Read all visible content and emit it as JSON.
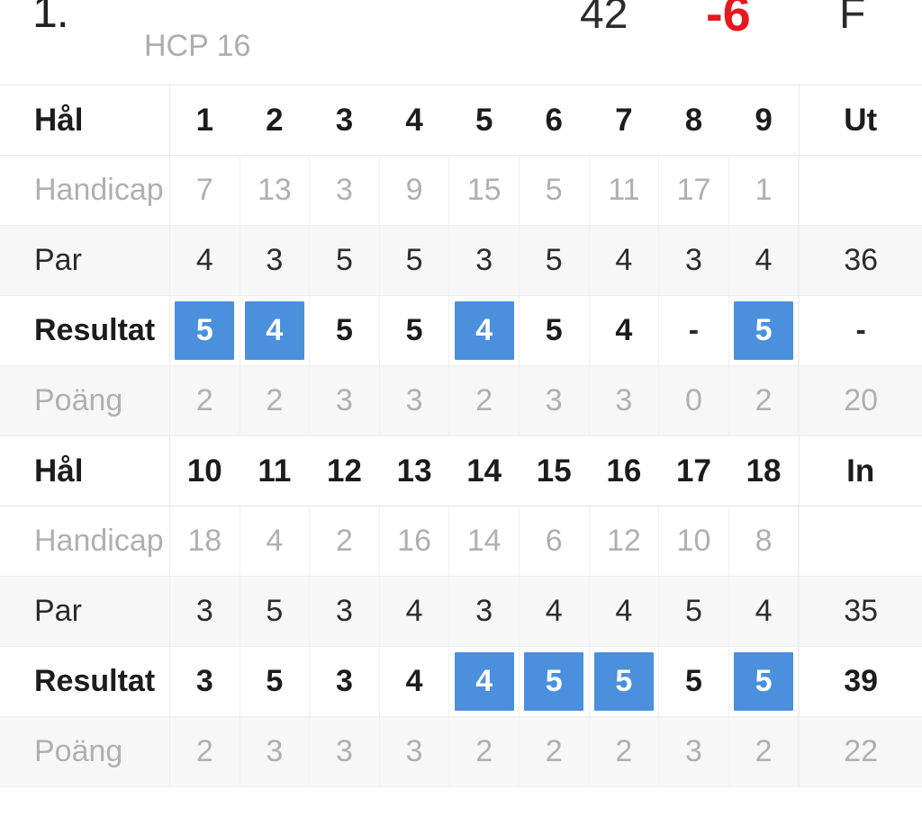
{
  "summary": {
    "rank": "1.",
    "hcp": "HCP 16",
    "score": "42",
    "to_par": "-6",
    "status": "F",
    "to_par_color": "#e8171f",
    "highlight_color": "#4a90dd"
  },
  "labels": {
    "hole": "Hål",
    "handicap": "Handicap",
    "par": "Par",
    "result": "Resultat",
    "points": "Poäng",
    "out": "Ut",
    "in": "In"
  },
  "front": {
    "holes": [
      "1",
      "2",
      "3",
      "4",
      "5",
      "6",
      "7",
      "8",
      "9"
    ],
    "total_label": "Ut",
    "handicap": [
      "7",
      "13",
      "3",
      "9",
      "15",
      "5",
      "11",
      "17",
      "1"
    ],
    "handicap_total": "",
    "par": [
      "4",
      "3",
      "5",
      "5",
      "3",
      "5",
      "4",
      "3",
      "4"
    ],
    "par_total": "36",
    "result": [
      "5",
      "4",
      "5",
      "5",
      "4",
      "5",
      "4",
      "-",
      "5"
    ],
    "result_highlight": [
      true,
      true,
      false,
      false,
      true,
      false,
      false,
      false,
      true
    ],
    "result_total": "-",
    "points": [
      "2",
      "2",
      "3",
      "3",
      "2",
      "3",
      "3",
      "0",
      "2"
    ],
    "points_total": "20"
  },
  "back": {
    "holes": [
      "10",
      "11",
      "12",
      "13",
      "14",
      "15",
      "16",
      "17",
      "18"
    ],
    "total_label": "In",
    "handicap": [
      "18",
      "4",
      "2",
      "16",
      "14",
      "6",
      "12",
      "10",
      "8"
    ],
    "handicap_total": "",
    "par": [
      "3",
      "5",
      "3",
      "4",
      "3",
      "4",
      "4",
      "5",
      "4"
    ],
    "par_total": "35",
    "result": [
      "3",
      "5",
      "3",
      "4",
      "4",
      "5",
      "5",
      "5",
      "5"
    ],
    "result_highlight": [
      false,
      false,
      false,
      false,
      true,
      true,
      true,
      false,
      true
    ],
    "result_total": "39",
    "points": [
      "2",
      "3",
      "3",
      "3",
      "2",
      "2",
      "2",
      "3",
      "2"
    ],
    "points_total": "22"
  }
}
